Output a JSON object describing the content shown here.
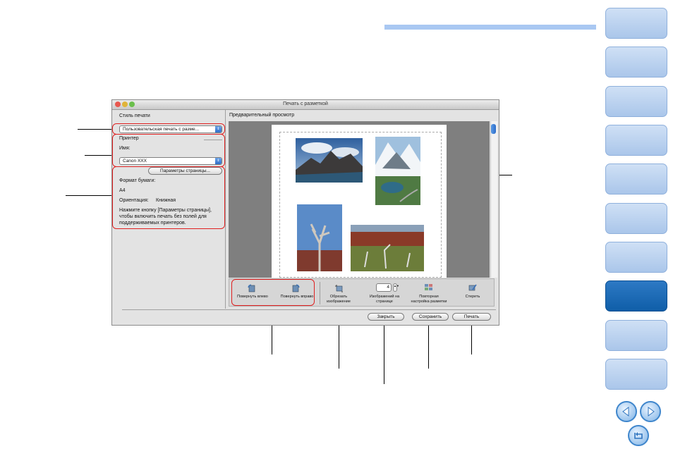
{
  "window": {
    "title": "Печать с разметкой",
    "print_style_label": "Стиль печати",
    "print_style_value": "Пользовательская печать с разме...",
    "printer_group_label": "Принтер",
    "printer_name_label": "Имя:",
    "printer_name_value": "Canon XXX",
    "page_setup_button": "Параметры страницы...",
    "paper_format_label": "Формат бумаги:",
    "paper_format_value": "A4",
    "orientation_label": "Ориентация:",
    "orientation_value": "Книжная",
    "note": "Нажмите кнопку [Параметры страницы], чтобы включить печать без полей для поддерживаемых принтеров.",
    "preview_label": "Предварительный просмотр",
    "toolbar": {
      "rotate_left": "Повернуть влево",
      "rotate_right": "Повернуть вправо",
      "crop_line1": "Обрезать",
      "crop_line2": "изображение",
      "per_page_value": "4",
      "per_page_line1": "Изображений на",
      "per_page_line2": "странице",
      "relayout_line1": "Повторная",
      "relayout_line2": "настройка разметки",
      "erase": "Стереть"
    },
    "buttons": {
      "close": "Закрыть",
      "save": "Сохранить",
      "print": "Печать"
    }
  },
  "colors": {
    "nav_tab": "#bcd3ef",
    "nav_tab_active": "#1565b5",
    "top_bar": "#a9c8f2",
    "callout_box": "#e02020"
  },
  "icons": [
    "rotate-left-icon",
    "rotate-right-icon",
    "crop-icon",
    "relayout-icon",
    "erase-icon",
    "prev-arrow-icon",
    "next-arrow-icon",
    "return-icon"
  ]
}
